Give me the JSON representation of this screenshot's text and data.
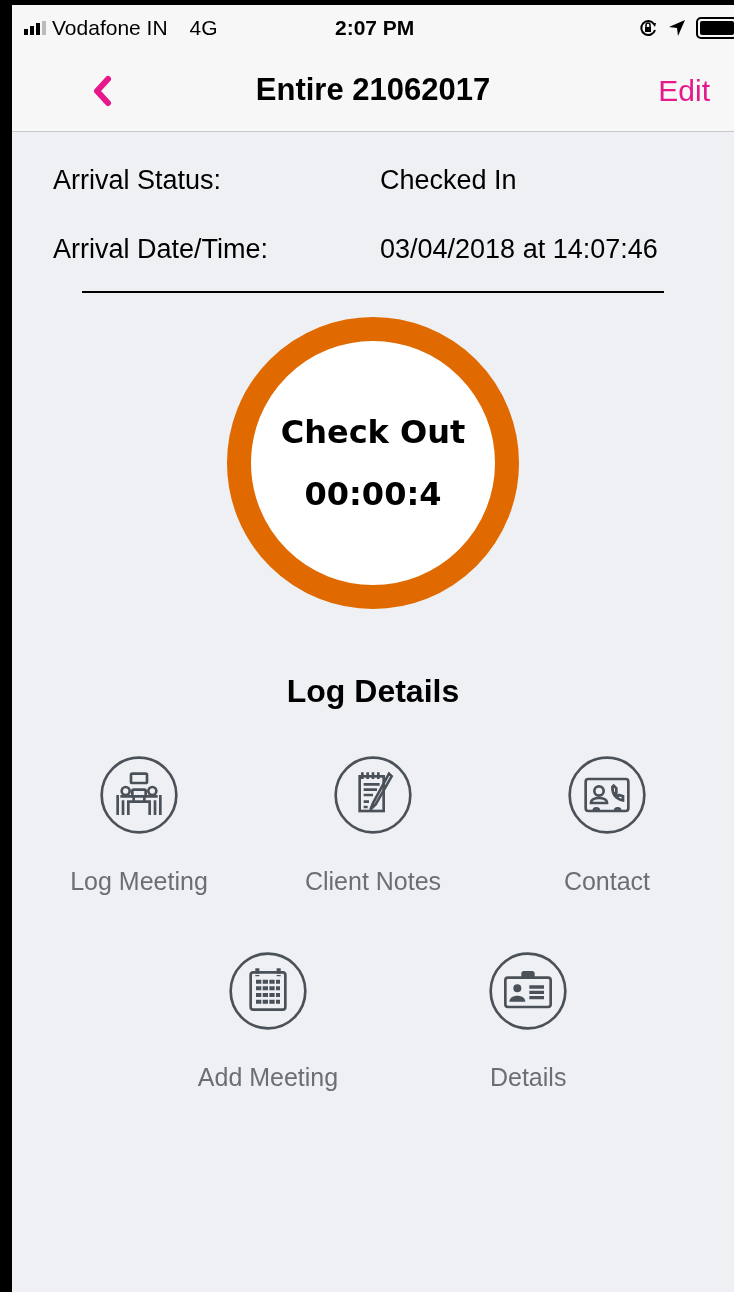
{
  "status_bar": {
    "carrier": "Vodafone IN",
    "network": "4G",
    "time": "2:07 PM"
  },
  "nav_bar": {
    "title": "Entire 21062017",
    "action": "Edit"
  },
  "info": [
    {
      "label": "Arrival Status:",
      "value": "Checked In"
    },
    {
      "label": "Arrival Date/Time:",
      "value": "03/04/2018 at 14:07:46"
    }
  ],
  "check_button": {
    "label": "Check Out",
    "timer": "00:00:4"
  },
  "log_details": {
    "title": "Log Details",
    "actions": [
      {
        "kind": "meeting",
        "label": "Log Meeting"
      },
      {
        "kind": "notes",
        "label": "Client Notes"
      },
      {
        "kind": "contact",
        "label": "Contact"
      },
      {
        "kind": "calendar",
        "label": "Add Meeting"
      },
      {
        "kind": "badge",
        "label": "Details"
      }
    ]
  }
}
